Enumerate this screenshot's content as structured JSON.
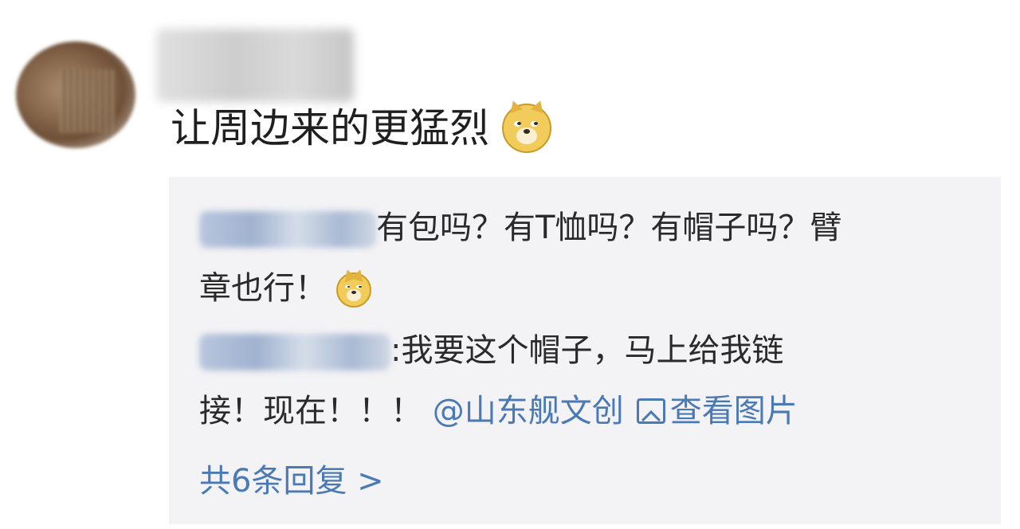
{
  "comment": {
    "text": "让周边来的更猛烈",
    "emoji": "doge-icon"
  },
  "replies": [
    {
      "text_line1": "有包吗？有T恤吗？有帽子吗？臂",
      "text_line2": "章也行！",
      "emoji": "doge-icon"
    },
    {
      "text_line1": ":我要这个帽子，马上给我链",
      "text_line2": "接！现在！！！",
      "mention": "@山东舰文创",
      "view_image_label": "查看图片"
    }
  ],
  "more_replies": {
    "label": "共6条回复 >"
  },
  "colors": {
    "link": "#4b79b4",
    "reply_background": "#f3f3f5",
    "text": "#1f1f1f"
  }
}
